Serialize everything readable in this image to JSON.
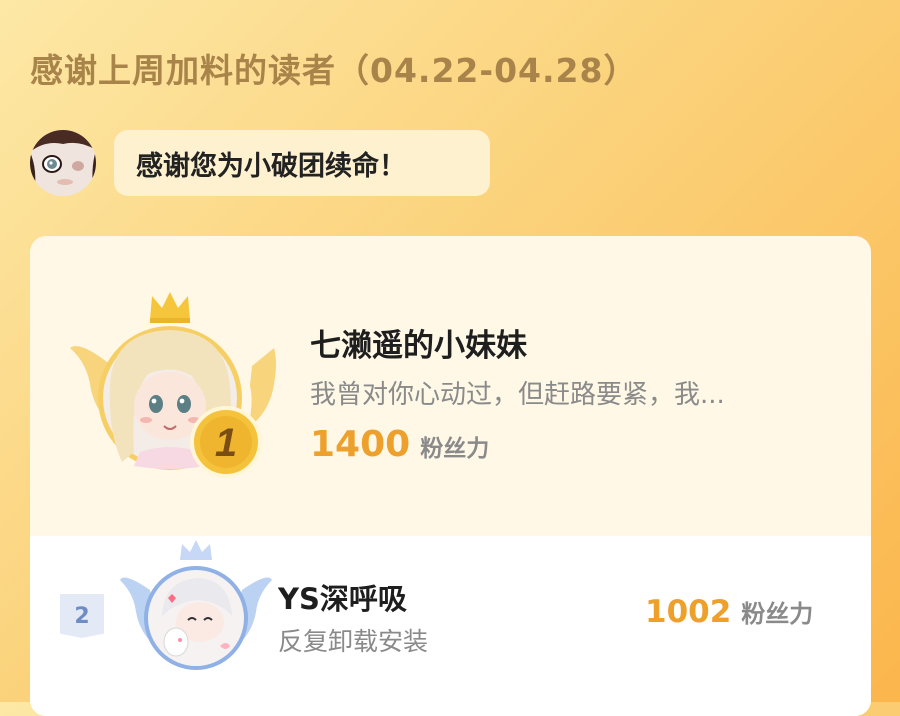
{
  "header": {
    "title": "感谢上周加料的读者（04.22-04.28）"
  },
  "message": {
    "text": "感谢您为小破团续命！"
  },
  "ranking": [
    {
      "rank": "1",
      "name": "七濑遥的小妹妹",
      "message": "我曾对你心动过，但赶路要紧，我...",
      "score": "1400",
      "unit": "粉丝力"
    },
    {
      "rank": "2",
      "name": "YS深呼吸",
      "message": "反复卸载安装",
      "score": "1002",
      "unit": "粉丝力"
    }
  ],
  "colors": {
    "background_top": "#fde8a6",
    "background_bottom": "#fbb64c",
    "title": "#a9844a",
    "score": "#eda02c",
    "gold": "#f3c23a",
    "silver_blue": "#8ab0e8"
  },
  "icons": [
    "crown-icon",
    "wings-icon",
    "rank-medal-icon"
  ]
}
